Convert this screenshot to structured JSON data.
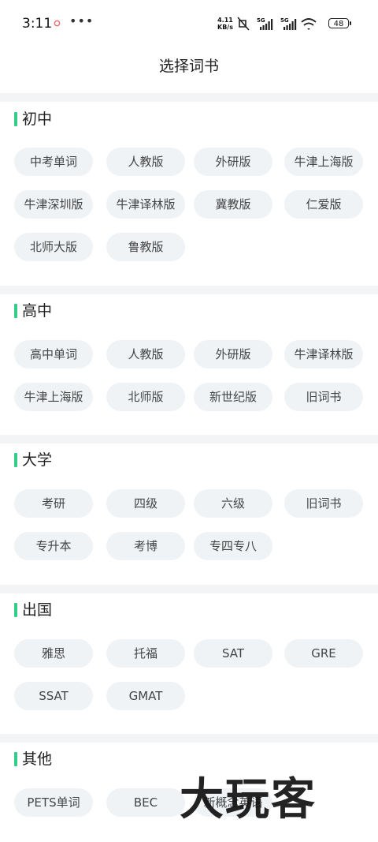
{
  "status_bar": {
    "time": "3:11",
    "more": "•••",
    "speed_value": "4.11",
    "speed_unit": "KB/s",
    "battery": "48"
  },
  "page_title": "选择词书",
  "sections": [
    {
      "title": "初中",
      "items": [
        "中考单词",
        "人教版",
        "外研版",
        "牛津上海版",
        "牛津深圳版",
        "牛津译林版",
        "冀教版",
        "仁爱版",
        "北师大版",
        "鲁教版"
      ]
    },
    {
      "title": "高中",
      "items": [
        "高中单词",
        "人教版",
        "外研版",
        "牛津译林版",
        "牛津上海版",
        "北师版",
        "新世纪版",
        "旧词书"
      ]
    },
    {
      "title": "大学",
      "items": [
        "考研",
        "四级",
        "六级",
        "旧词书",
        "专升本",
        "考博",
        "专四专八"
      ]
    },
    {
      "title": "出国",
      "items": [
        "雅思",
        "托福",
        "SAT",
        "GRE",
        "SSAT",
        "GMAT"
      ]
    },
    {
      "title": "其他",
      "items": [
        "PETS单词",
        "BEC",
        "新概念英语"
      ]
    }
  ],
  "watermark": "大玩客",
  "colors": {
    "accent": "#33cc88",
    "chip_bg": "#f0f3f6",
    "separator": "#f2f4f6"
  }
}
